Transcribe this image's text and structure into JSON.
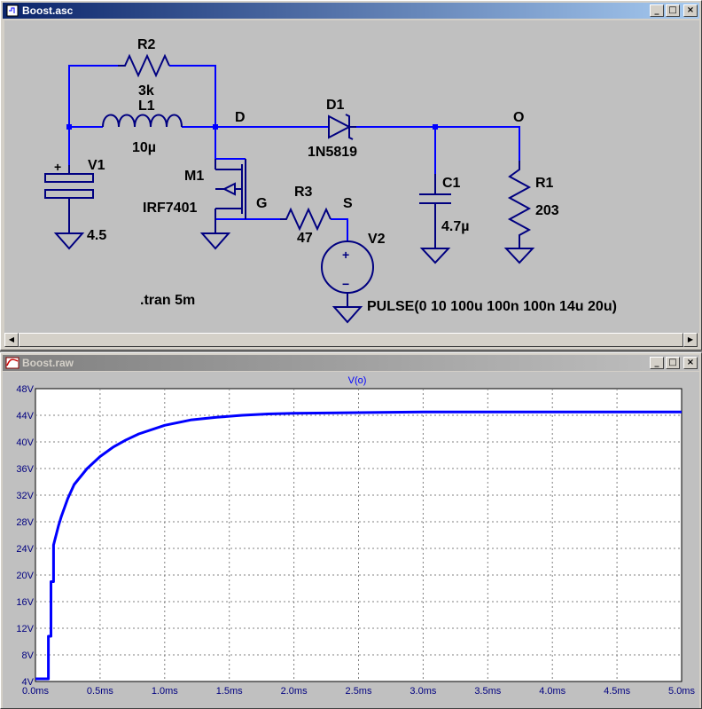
{
  "schematic_window": {
    "title": "Boost.asc",
    "controls": {
      "minimize": "_",
      "maximize": "□",
      "close": "×"
    },
    "labels": {
      "R2": "R2",
      "R2_value": "3k",
      "L1": "L1",
      "L1_value": "10µ",
      "node_D": "D",
      "D1": "D1",
      "D1_value": "1N5819",
      "node_O": "O",
      "V1": "V1",
      "V1_value": "4.5",
      "M1": "M1",
      "M1_value": "IRF7401",
      "node_G": "G",
      "R3": "R3",
      "R3_value": "47",
      "node_S": "S",
      "C1": "C1",
      "C1_value": "4.7µ",
      "R1": "R1",
      "R1_value": "203",
      "V2": "V2",
      "pulse": "PULSE(0 10 100u 100n 100n 14u 20u)",
      "directive": ".tran 5m",
      "v1_plus": "+",
      "v2_plus": "+",
      "v2_minus": "−"
    },
    "colors": {
      "wire": "#0000ff",
      "component": "#000080",
      "background": "#c0c0c0"
    }
  },
  "waveform_window": {
    "title": "Boost.raw",
    "controls": {
      "minimize": "_",
      "maximize": "□",
      "close": "×"
    }
  },
  "chart_data": {
    "type": "line",
    "title": "V(o)",
    "xlabel": "",
    "ylabel": "",
    "xlim": [
      0,
      5.0
    ],
    "ylim": [
      4,
      48
    ],
    "x_ticks": [
      "0.0ms",
      "0.5ms",
      "1.0ms",
      "1.5ms",
      "2.0ms",
      "2.5ms",
      "3.0ms",
      "3.5ms",
      "4.0ms",
      "4.5ms",
      "5.0ms"
    ],
    "y_ticks": [
      "4V",
      "8V",
      "12V",
      "16V",
      "20V",
      "24V",
      "28V",
      "32V",
      "36V",
      "40V",
      "44V",
      "48V"
    ],
    "grid": true,
    "series": [
      {
        "name": "V(o)",
        "color": "#0000ff",
        "x": [
          0,
          0.1,
          0.1,
          0.12,
          0.12,
          0.14,
          0.14,
          0.16,
          0.18,
          0.2,
          0.25,
          0.3,
          0.4,
          0.5,
          0.6,
          0.7,
          0.8,
          1.0,
          1.2,
          1.4,
          1.6,
          1.8,
          2.0,
          2.5,
          3.0,
          3.5,
          4.0,
          4.5,
          5.0
        ],
        "y": [
          4.4,
          4.4,
          10.8,
          10.8,
          19.0,
          19.0,
          24.5,
          26.0,
          27.5,
          28.8,
          31.5,
          33.6,
          36.0,
          37.8,
          39.2,
          40.3,
          41.2,
          42.5,
          43.3,
          43.7,
          44.0,
          44.2,
          44.3,
          44.4,
          44.5,
          44.5,
          44.5,
          44.5,
          44.5
        ]
      }
    ]
  }
}
